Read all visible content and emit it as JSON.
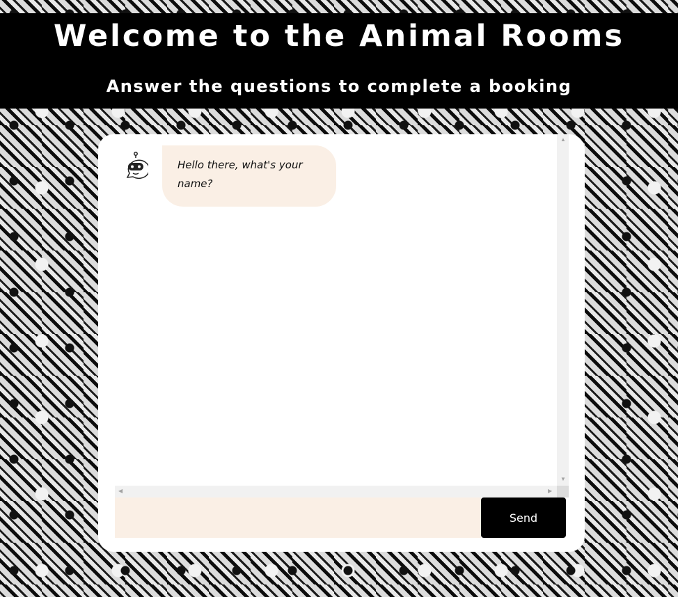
{
  "header": {
    "title": "Welcome to the Animal Rooms",
    "subtitle": "Answer the questions to complete a booking"
  },
  "chat": {
    "messages": [
      {
        "sender": "bot",
        "avatar_icon": "robot-icon",
        "text": "Hello there, what's your name?"
      }
    ],
    "input": {
      "value": "",
      "placeholder": ""
    },
    "send_label": "Send"
  },
  "colors": {
    "header_bg": "#000000",
    "header_text": "#ffffff",
    "bubble_bg": "#faefe5",
    "input_bg": "#faefe5",
    "send_bg": "#000000",
    "card_bg": "#ffffff"
  }
}
